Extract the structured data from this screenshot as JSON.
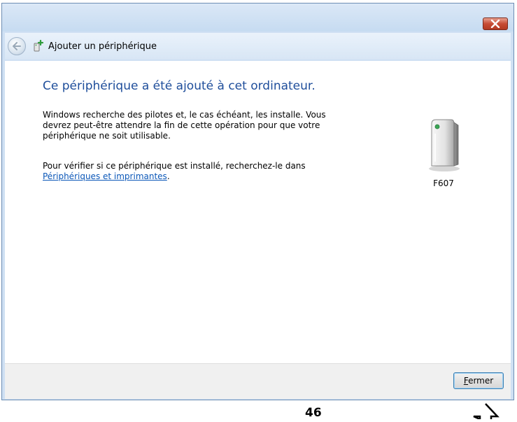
{
  "window": {
    "title": "Ajouter un périphérique"
  },
  "content": {
    "heading": "Ce périphérique a été ajouté à cet ordinateur.",
    "paragraph1": "Windows recherche des pilotes et, le cas échéant, les installe. Vous devrez peut-être attendre la fin de cette opération pour que votre périphérique ne soit utilisable.",
    "paragraph2_text": "Pour vérifier si ce périphérique est installé, recherchez-le dans",
    "paragraph2_link": "Périphériques et imprimantes",
    "paragraph2_suffix": ".",
    "device_name": "F607"
  },
  "footer": {
    "close_mnemonic": "F",
    "close_rest": "ermer"
  },
  "annotation": {
    "page_number": "46"
  },
  "icons": {
    "title_close": "close-x-icon",
    "back": "back-arrow-icon",
    "device_small": "add-device-icon",
    "device_large": "device-tower-icon",
    "annotation_arrow": "up-arrow-icon"
  },
  "colors": {
    "heading": "#1f4e9b",
    "link": "#0b57b8",
    "close_button_red": "#c74b34"
  }
}
